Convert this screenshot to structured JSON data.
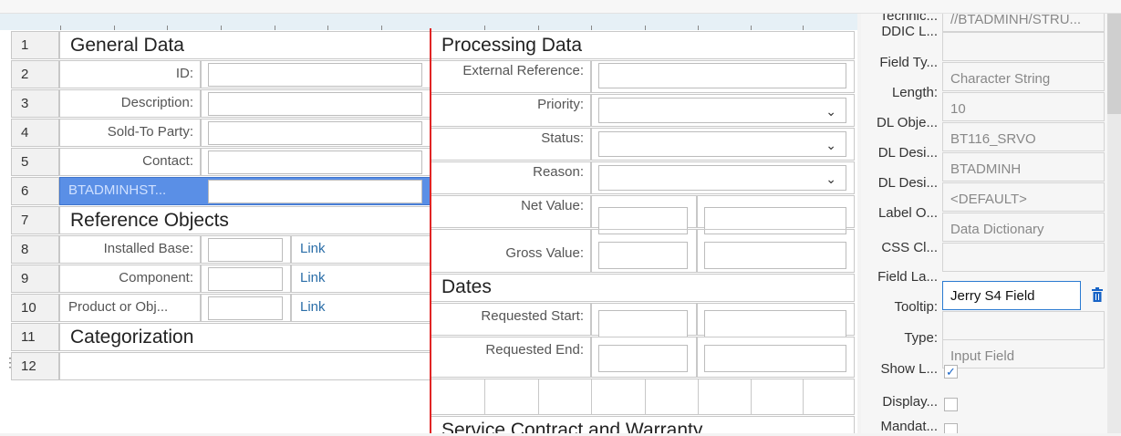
{
  "row_numbers": [
    "1",
    "2",
    "3",
    "4",
    "5",
    "6",
    "7",
    "8",
    "9",
    "10",
    "11",
    "12"
  ],
  "left": {
    "general_title": "General Data",
    "id_label": "ID:",
    "description_label": "Description:",
    "sold_to_label": "Sold-To Party:",
    "contact_label": "Contact:",
    "custom_field_label": "BTADMINHST...",
    "reference_title": "Reference Objects",
    "installed_base_label": "Installed Base:",
    "component_label": "Component:",
    "product_label": "Product or Obj...",
    "link_text": "Link",
    "categorization_title": "Categorization"
  },
  "middle": {
    "processing_title": "Processing Data",
    "external_ref_label": "External Reference:",
    "priority_label": "Priority:",
    "status_label": "Status:",
    "reason_label": "Reason:",
    "net_value_label": "Net Value:",
    "gross_value_label": "Gross Value:",
    "dates_title": "Dates",
    "req_start_label": "Requested Start:",
    "req_end_label": "Requested End:",
    "service_title": "Service Contract and Warranty"
  },
  "properties": [
    {
      "label": "Technic...",
      "value": "//BTADMINH/STRU..."
    },
    {
      "label": "DDIC L...",
      "value": ""
    },
    {
      "label": "Field Ty...",
      "value": "Character String"
    },
    {
      "label": "Length:",
      "value": "10"
    },
    {
      "label": "DL Obje...",
      "value": "BT116_SRVO"
    },
    {
      "label": "DL Desi...",
      "value": "BTADMINH"
    },
    {
      "label": "DL Desi...",
      "value": "<DEFAULT>"
    },
    {
      "label": "Label O...",
      "value": "Data Dictionary"
    },
    {
      "label": "CSS Cl...",
      "value": ""
    },
    {
      "label": "Field La...",
      "value": "Jerry S4 Field"
    },
    {
      "label": "Tooltip:",
      "value": ""
    },
    {
      "label": "Type:",
      "value": "Input Field"
    },
    {
      "label": "Show L...",
      "value": "✓"
    },
    {
      "label": "Display...",
      "value": ""
    },
    {
      "label": "Mandat...",
      "value": ""
    }
  ],
  "colors": {
    "accent_red": "#e02424",
    "selected_blue": "#5a8fe6",
    "link_blue": "#2b6ea8",
    "active_border": "#2a7ad1",
    "delete_icon": "#1763c6"
  }
}
